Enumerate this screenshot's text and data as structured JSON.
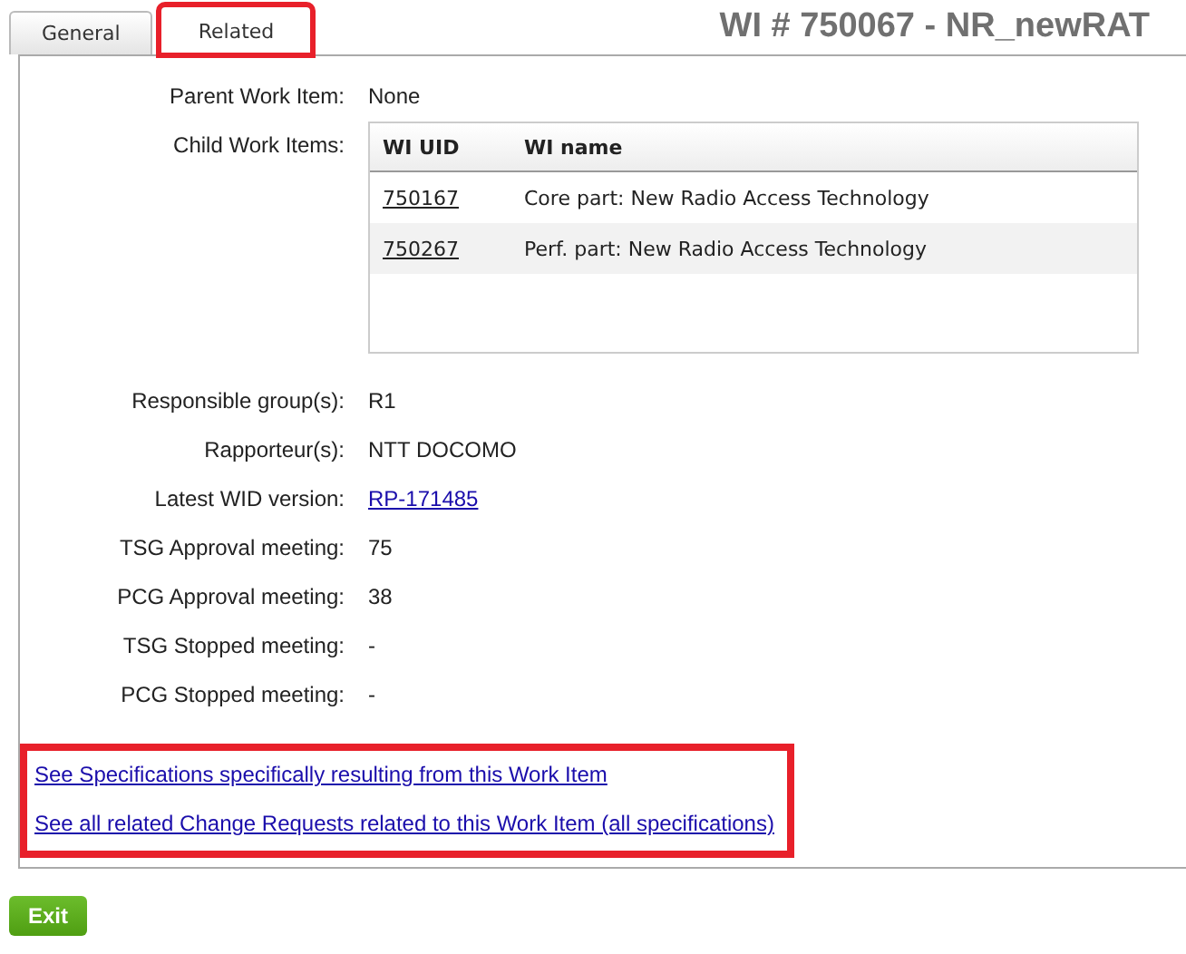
{
  "tabs": [
    {
      "label": "General",
      "selected": false,
      "highlighted": false
    },
    {
      "label": "Related",
      "selected": true,
      "highlighted": true
    }
  ],
  "title": "WI # 750067 - NR_newRAT",
  "fields": [
    {
      "kind": "text",
      "label": "Parent Work Item:",
      "value": "None"
    },
    {
      "kind": "table",
      "label": "Child Work Items:",
      "columns": [
        "WI UID",
        "WI name"
      ],
      "rows": [
        {
          "uid": "750167",
          "name": "Core part: New Radio Access Technology"
        },
        {
          "uid": "750267",
          "name": "Perf. part: New Radio Access Technology"
        }
      ]
    },
    {
      "kind": "text",
      "label": "Responsible group(s):",
      "value": "R1"
    },
    {
      "kind": "text",
      "label": "Rapporteur(s):",
      "value": "NTT DOCOMO"
    },
    {
      "kind": "link",
      "label": "Latest WID version:",
      "value": "RP-171485"
    },
    {
      "kind": "text",
      "label": "TSG Approval meeting:",
      "value": "75"
    },
    {
      "kind": "text",
      "label": "PCG Approval meeting:",
      "value": "38"
    },
    {
      "kind": "text",
      "label": "TSG Stopped meeting:",
      "value": "-"
    },
    {
      "kind": "text",
      "label": "PCG Stopped meeting:",
      "value": "-"
    }
  ],
  "links": {
    "highlighted": true,
    "items": [
      "See Specifications specifically resulting from this Work Item",
      "See all related Change Requests related to this Work Item (all specifications)"
    ]
  },
  "exit_button": "Exit"
}
